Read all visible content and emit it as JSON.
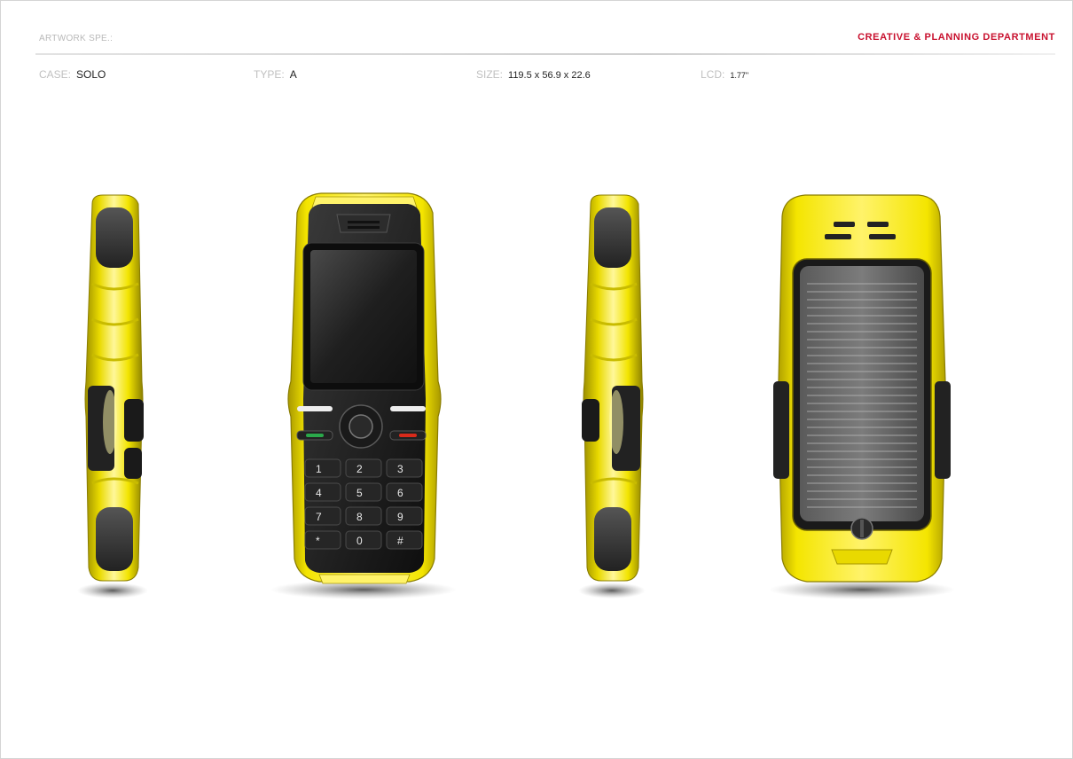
{
  "header": {
    "left_title": "ARTWORK SPE.:",
    "right_title": "CREATIVE & PLANNING DEPARTMENT"
  },
  "specs": {
    "case_label": "CASE:",
    "case_value": "SOLO",
    "type_label": "TYPE:",
    "type_value": "A",
    "size_label": "SIZE:",
    "size_value": "119.5 x 56.9 x 22.6",
    "lcd_label": "LCD:",
    "lcd_value": "1.77\""
  },
  "keypad": [
    "1",
    "2",
    "3",
    "4",
    "5",
    "6",
    "7",
    "8",
    "9",
    "*",
    "0",
    "#"
  ],
  "colors": {
    "body_yellow": "#f2e400",
    "rubber_black": "#1c1c1c",
    "accent_red": "#c8102e",
    "call_green": "#2aa84a",
    "end_red": "#d92a1a"
  },
  "icons": [
    "phone-left-side-view",
    "phone-front-view",
    "phone-right-side-view",
    "phone-back-view-solar-panel"
  ]
}
